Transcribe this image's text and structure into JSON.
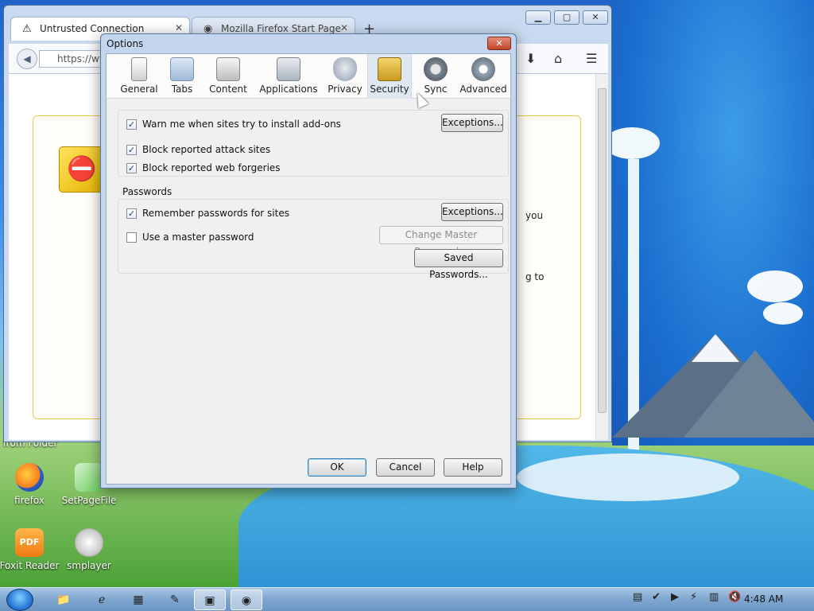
{
  "desktop": {
    "icons": [
      {
        "label": "firefox"
      },
      {
        "label": "SetPageFile"
      },
      {
        "label": "Foxit Reader"
      },
      {
        "label": "smplayer"
      }
    ],
    "partial_label": "from Folder"
  },
  "browser": {
    "tabs": [
      {
        "label": "Untrusted Connection",
        "icon": "warning-icon"
      },
      {
        "label": "Mozilla Firefox Start Page",
        "icon": "firefox-icon"
      }
    ],
    "url_text": "https://ww",
    "background_text": [
      "you",
      "g to"
    ]
  },
  "dialog": {
    "title": "Options",
    "panes": [
      {
        "label": "General",
        "icon": "general-icon"
      },
      {
        "label": "Tabs",
        "icon": "tabs-icon"
      },
      {
        "label": "Content",
        "icon": "content-icon"
      },
      {
        "label": "Applications",
        "icon": "applications-icon"
      },
      {
        "label": "Privacy",
        "icon": "privacy-icon"
      },
      {
        "label": "Security",
        "icon": "lock-icon",
        "selected": true
      },
      {
        "label": "Sync",
        "icon": "sync-icon"
      },
      {
        "label": "Advanced",
        "icon": "gear-icon"
      }
    ],
    "general_group": {
      "warn_addons": {
        "label": "Warn me when sites try to install add-ons",
        "checked": true
      },
      "block_attack": {
        "label": "Block reported attack sites",
        "checked": true
      },
      "block_forgeries": {
        "label": "Block reported web forgeries",
        "checked": true
      },
      "exceptions_label": "Exceptions..."
    },
    "passwords_group": {
      "title": "Passwords",
      "remember": {
        "label": "Remember passwords for sites",
        "checked": true
      },
      "master": {
        "label": "Use a master password",
        "checked": false
      },
      "exceptions_label": "Exceptions...",
      "change_master_label": "Change Master Password...",
      "saved_passwords_label": "Saved Passwords..."
    },
    "buttons": {
      "ok": "OK",
      "cancel": "Cancel",
      "help": "Help"
    }
  },
  "taskbar": {
    "clock": "4:48 AM"
  },
  "colors": {
    "dialog_frame": "#c4d6ee",
    "close_red": "#c24529",
    "taskbar": "#7ea6cf"
  }
}
